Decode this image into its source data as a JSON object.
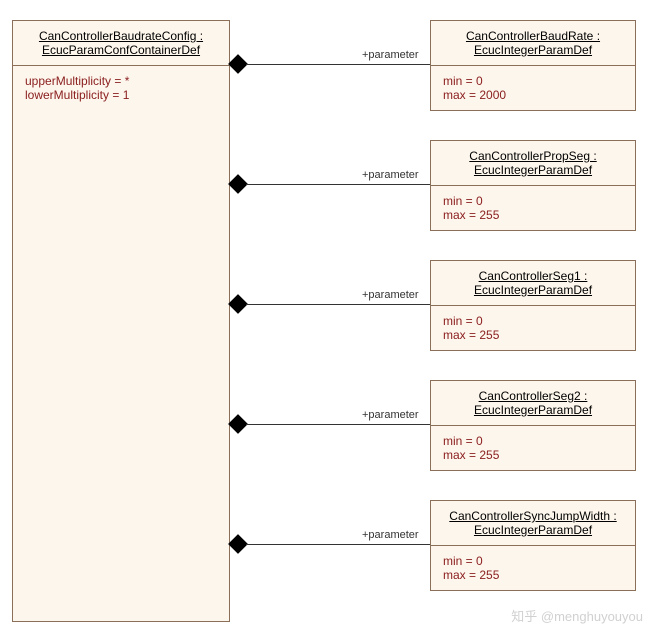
{
  "container": {
    "header_line1": "CanControllerBaudrateConfig :",
    "header_line2": "EcucParamConfContainerDef",
    "upper": "upperMultiplicity = *",
    "lower": "lowerMultiplicity = 1"
  },
  "role": "+parameter",
  "params": [
    {
      "name_line1": "CanControllerBaudRate :",
      "name_line2": "EcucIntegerParamDef",
      "min": "min = 0",
      "max": "max = 2000"
    },
    {
      "name_line1": "CanControllerPropSeg :",
      "name_line2": "EcucIntegerParamDef",
      "min": "min = 0",
      "max": "max = 255"
    },
    {
      "name_line1": "CanControllerSeg1 :",
      "name_line2": "EcucIntegerParamDef",
      "min": "min = 0",
      "max": "max = 255"
    },
    {
      "name_line1": "CanControllerSeg2 :",
      "name_line2": "EcucIntegerParamDef",
      "min": "min = 0",
      "max": "max = 255"
    },
    {
      "name_line1": "CanControllerSyncJumpWidth :",
      "name_line2": "EcucIntegerParamDef",
      "min": "min = 0",
      "max": "max = 255"
    }
  ],
  "chart_data": {
    "type": "table",
    "title": "CanControllerBaudrateConfig : EcucParamConfContainerDef",
    "container_multiplicity": {
      "upper": "*",
      "lower": 1
    },
    "parameters": [
      {
        "name": "CanControllerBaudRate",
        "type": "EcucIntegerParamDef",
        "min": 0,
        "max": 2000
      },
      {
        "name": "CanControllerPropSeg",
        "type": "EcucIntegerParamDef",
        "min": 0,
        "max": 255
      },
      {
        "name": "CanControllerSeg1",
        "type": "EcucIntegerParamDef",
        "min": 0,
        "max": 255
      },
      {
        "name": "CanControllerSeg2",
        "type": "EcucIntegerParamDef",
        "min": 0,
        "max": 255
      },
      {
        "name": "CanControllerSyncJumpWidth",
        "type": "EcucIntegerParamDef",
        "min": 0,
        "max": 255
      }
    ]
  },
  "watermark": "知乎 @menghuyouyou"
}
